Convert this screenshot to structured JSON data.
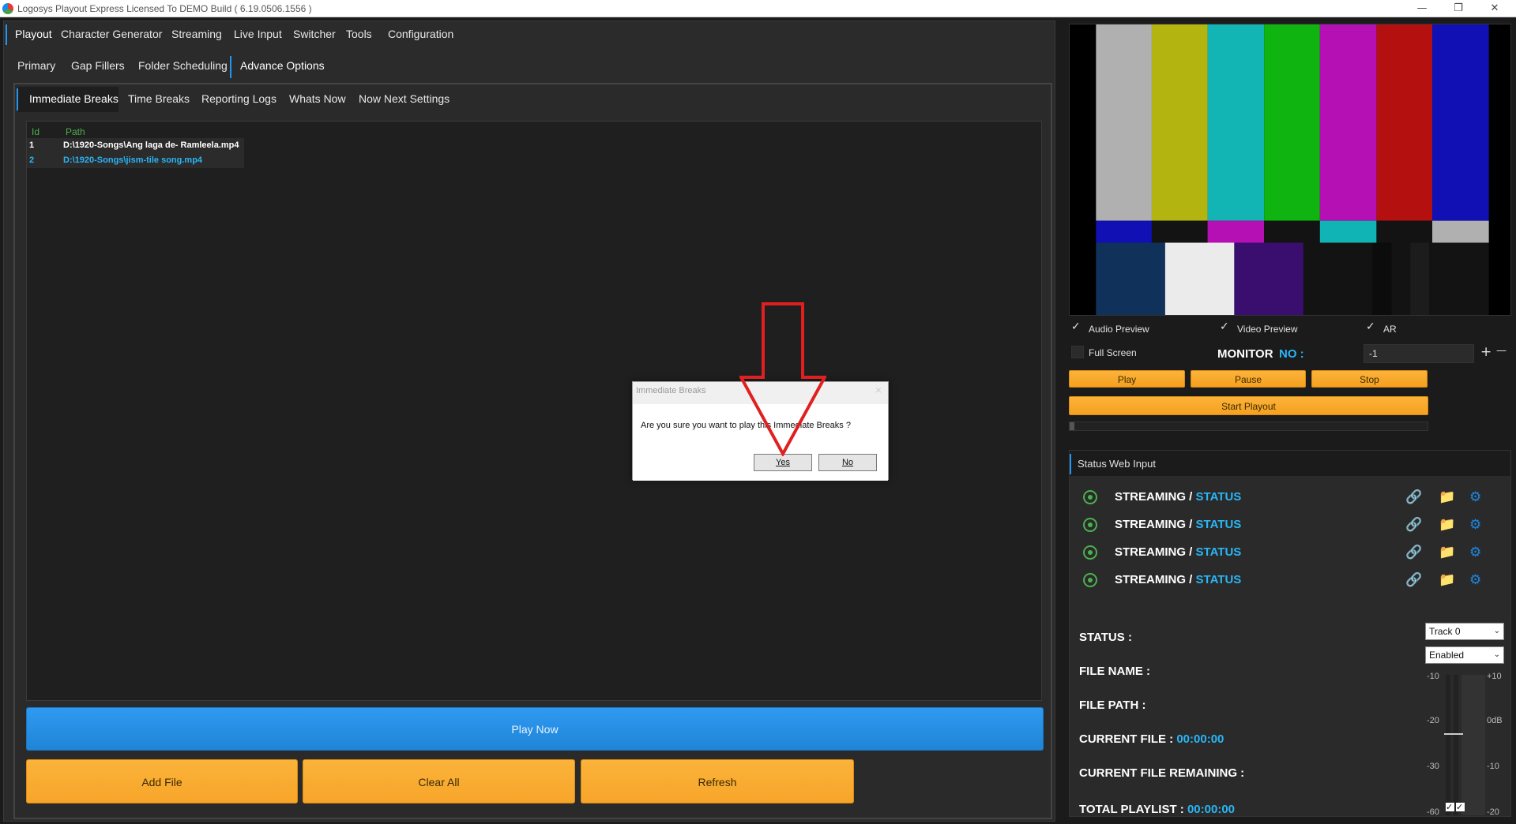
{
  "window": {
    "title": "Logosys Playout Express Licensed To DEMO Build ( 6.19.0506.1556 )",
    "minimize": "—",
    "maximize": "❐",
    "close": "✕"
  },
  "menu": [
    "Playout",
    "Character Generator",
    "Streaming",
    "Live Input",
    "Switcher",
    "Tools",
    "Configuration"
  ],
  "submenu": [
    "Primary",
    "Gap Fillers",
    "Folder Scheduling",
    "Advance Options"
  ],
  "tabs": [
    "Immediate Breaks",
    "Time Breaks",
    "Reporting Logs",
    "Whats Now",
    "Now Next Settings"
  ],
  "list": {
    "headers": {
      "id": "Id",
      "path": "Path"
    },
    "rows": [
      {
        "id": "1",
        "path": "D:\\1920-Songs\\Ang laga de- Ramleela.mp4",
        "color": "#ffffff"
      },
      {
        "id": "2",
        "path": "D:\\1920-Songs\\jism-tile song.mp4",
        "color": "#29b6f6"
      }
    ]
  },
  "buttons": {
    "play_now": "Play Now",
    "add_file": "Add File",
    "clear_all": "Clear All",
    "refresh": "Refresh"
  },
  "dialog": {
    "title": "Immediate Breaks",
    "close": "×",
    "message": "Are you sure you want to play this Immediate Breaks  ?",
    "yes": "Yes",
    "no": "No"
  },
  "preview": {
    "audio_preview": "Audio Preview",
    "video_preview": "Video Preview",
    "ar": "AR",
    "full_screen": "Full Screen",
    "monitor": "MONITOR",
    "monitor_no": "NO :",
    "monitor_value": "-1",
    "plus": "+",
    "minus": "—",
    "check": "✓"
  },
  "transport": {
    "play": "Play",
    "pause": "Pause",
    "stop": "Stop",
    "start_playout": "Start Playout"
  },
  "status_tabs": [
    "Status",
    "Web Input"
  ],
  "streams": [
    {
      "label": "STREAMING / ",
      "status": "STATUS"
    },
    {
      "label": "STREAMING / ",
      "status": "STATUS"
    },
    {
      "label": "STREAMING / ",
      "status": "STATUS"
    },
    {
      "label": "STREAMING / ",
      "status": "STATUS"
    }
  ],
  "fields": {
    "status": "STATUS :",
    "file_name": "FILE NAME :",
    "file_path": "FILE PATH :",
    "current_file": "CURRENT FILE : ",
    "current_file_val": "00:00:00",
    "current_file_remaining": "CURRENT FILE REMAINING :",
    "total_playlist": "TOTAL PLAYLIST : ",
    "total_playlist_val": "00:00:00"
  },
  "selects": {
    "track": "Track 0",
    "enabled": "Enabled",
    "caret": "⌄"
  },
  "vu": {
    "left": [
      "-10",
      "-20",
      "-30",
      "-60"
    ],
    "right": [
      "+10",
      "0dB",
      "-10",
      "-20"
    ]
  },
  "colors": {
    "accent": "#2196f3",
    "orange": "#f7a52a",
    "status_blue": "#29b6f6",
    "green": "#4caf50"
  }
}
